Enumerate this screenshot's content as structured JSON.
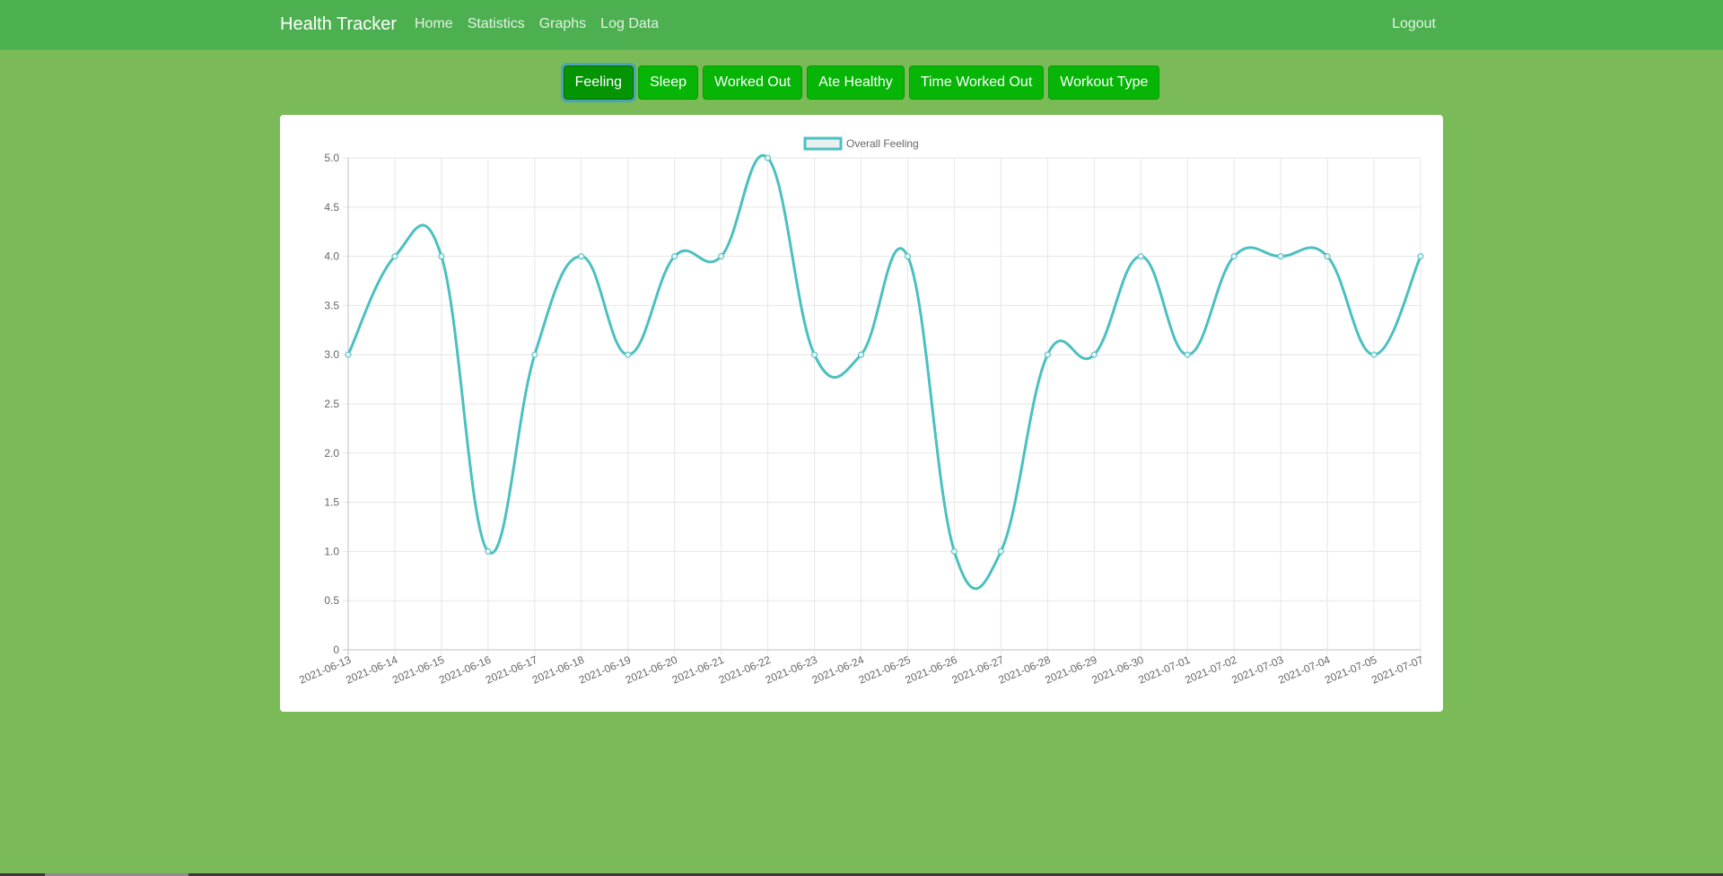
{
  "navbar": {
    "brand": "Health Tracker",
    "links": [
      "Home",
      "Statistics",
      "Graphs",
      "Log Data"
    ],
    "logout": "Logout"
  },
  "tabs": [
    {
      "label": "Feeling",
      "active": true
    },
    {
      "label": "Sleep",
      "active": false
    },
    {
      "label": "Worked Out",
      "active": false
    },
    {
      "label": "Ate Healthy",
      "active": false
    },
    {
      "label": "Time Worked Out",
      "active": false
    },
    {
      "label": "Workout Type",
      "active": false
    }
  ],
  "colors": {
    "page_background": "#7aba57",
    "navbar": "#4cb050",
    "button": "#06b506",
    "line": "#4bc0c0",
    "legend_fill": "#e8f0f0"
  },
  "chart_data": {
    "type": "line",
    "x": [
      "2021-06-13",
      "2021-06-14",
      "2021-06-15",
      "2021-06-16",
      "2021-06-17",
      "2021-06-18",
      "2021-06-19",
      "2021-06-20",
      "2021-06-21",
      "2021-06-22",
      "2021-06-23",
      "2021-06-24",
      "2021-06-25",
      "2021-06-26",
      "2021-06-27",
      "2021-06-28",
      "2021-06-29",
      "2021-06-30",
      "2021-07-01",
      "2021-07-02",
      "2021-07-03",
      "2021-07-04",
      "2021-07-05",
      "2021-07-07"
    ],
    "series": [
      {
        "name": "Overall Feeling",
        "values": [
          3,
          4,
          4,
          1,
          3,
          4,
          3,
          4,
          4,
          5,
          3,
          3,
          4,
          1,
          1,
          3,
          3,
          4,
          3,
          4,
          4,
          4,
          3,
          4
        ]
      }
    ],
    "yticks": [
      "0",
      "0.5",
      "1.0",
      "1.5",
      "2.0",
      "2.5",
      "3.0",
      "3.5",
      "4.0",
      "4.5",
      "5.0"
    ],
    "ylim": [
      0,
      5
    ],
    "grid": true,
    "legend": "top-center"
  }
}
